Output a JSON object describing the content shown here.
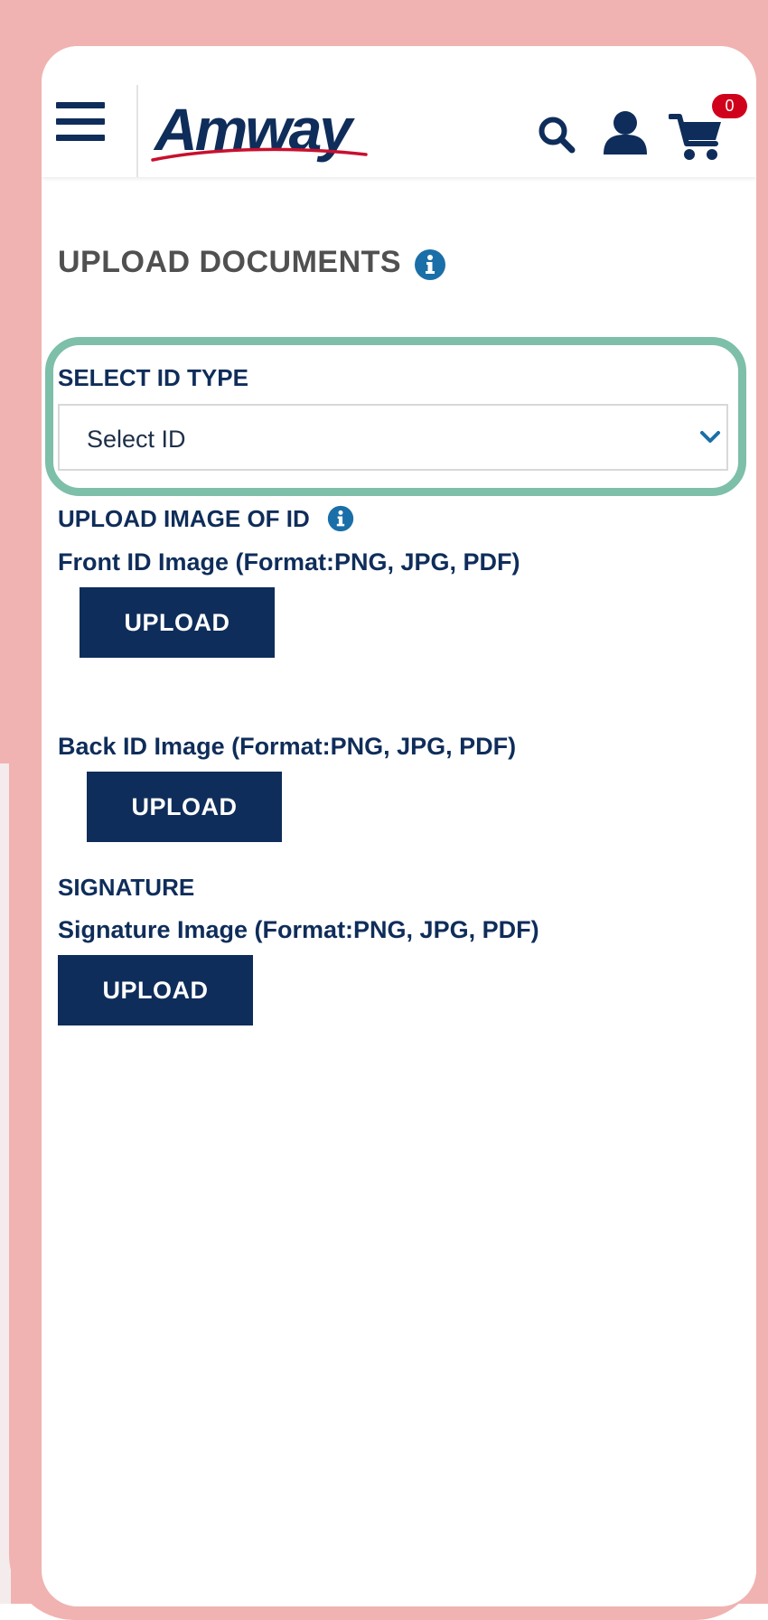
{
  "header": {
    "logo_text": "Amway",
    "cart_count": "0"
  },
  "page": {
    "title": "UPLOAD DOCUMENTS"
  },
  "id_type": {
    "label": "SELECT ID TYPE",
    "selected_value": "Select ID"
  },
  "upload_image": {
    "label": "UPLOAD IMAGE OF ID",
    "front_label": "Front ID Image (Format:PNG, JPG, PDF)",
    "front_button": "UPLOAD",
    "back_label": "Back ID Image (Format:PNG, JPG, PDF)",
    "back_button": "UPLOAD"
  },
  "signature": {
    "label": "SIGNATURE",
    "image_label": "Signature Image (Format:PNG, JPG, PDF)",
    "button": "UPLOAD"
  },
  "icons": [
    "menu-icon",
    "search-icon",
    "user-icon",
    "cart-icon",
    "info-icon",
    "chevron-down-icon"
  ],
  "colors": {
    "brand_navy": "#0f2d5a",
    "info_blue": "#1b6fa8",
    "badge_red": "#d0021b",
    "highlight_green": "#7dbfa9",
    "frame_pink": "#f0b3b1"
  }
}
